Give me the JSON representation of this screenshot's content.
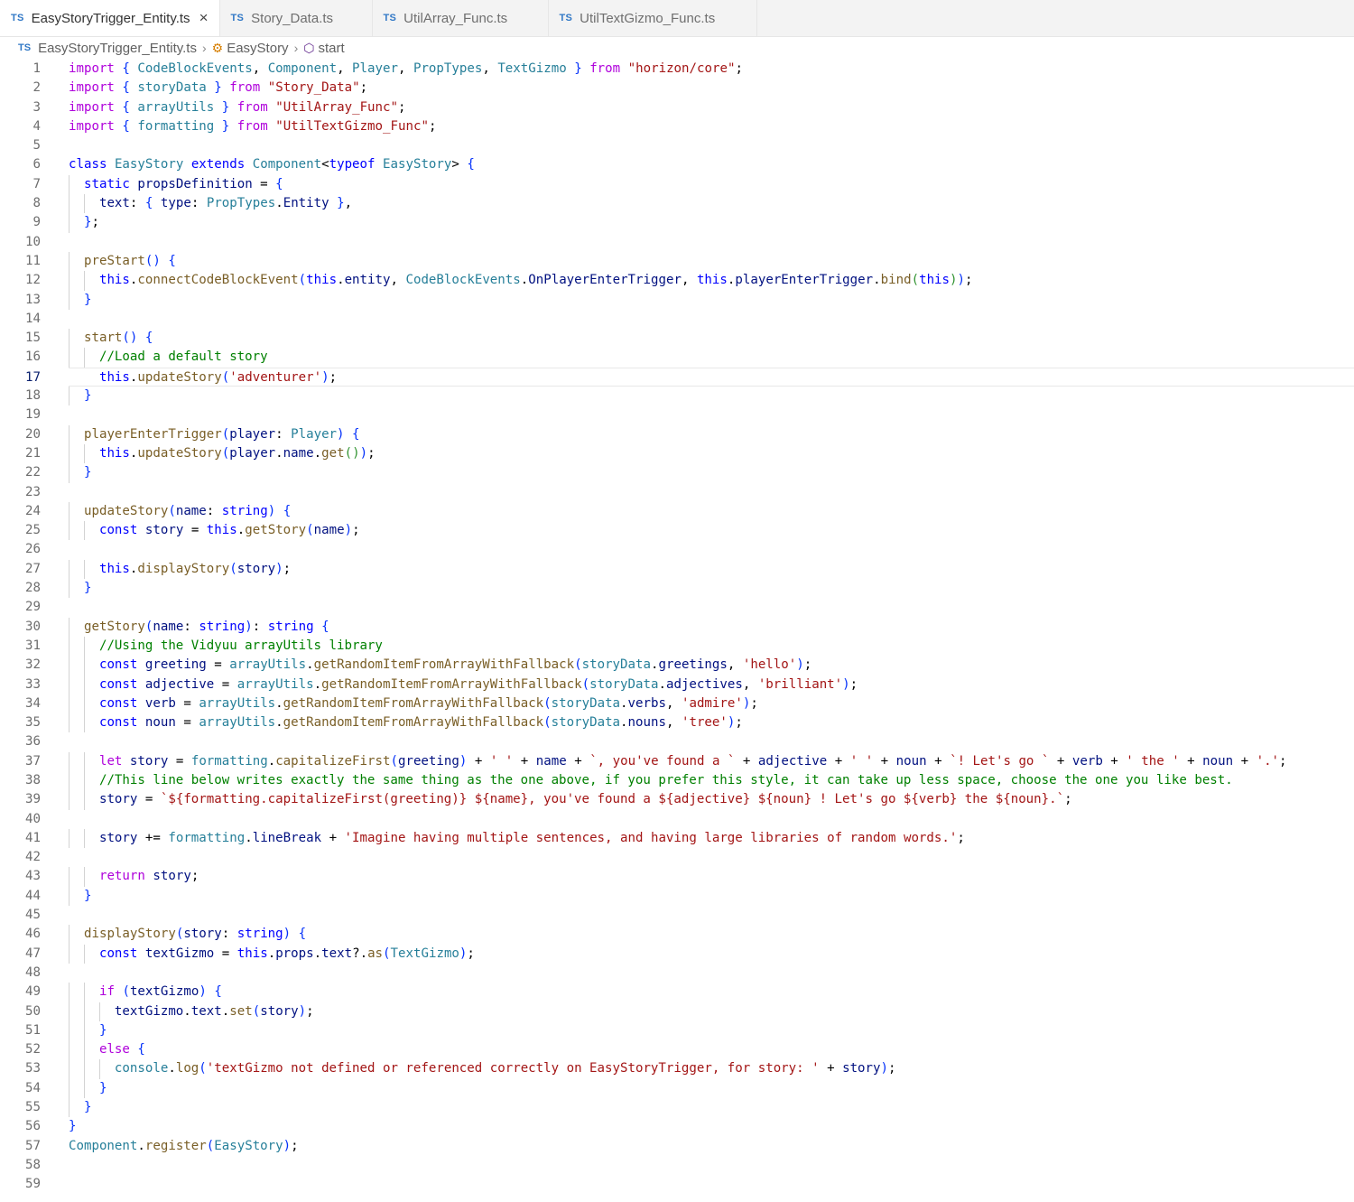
{
  "tabs": [
    {
      "badge": "TS",
      "label": "EasyStoryTrigger_Entity.ts",
      "active": true
    },
    {
      "badge": "TS",
      "label": "Story_Data.ts",
      "active": false
    },
    {
      "badge": "TS",
      "label": "UtilArray_Func.ts",
      "active": false
    },
    {
      "badge": "TS",
      "label": "UtilTextGizmo_Func.ts",
      "active": false
    }
  ],
  "tab_close_icon": "close-icon",
  "breadcrumb": {
    "badge": "TS",
    "file": "EasyStoryTrigger_Entity.ts",
    "class_name": "EasyStory",
    "method_name": "start"
  },
  "editor": {
    "current_line": 17,
    "line_numbers": [
      "1",
      "2",
      "3",
      "4",
      "5",
      "6",
      "7",
      "8",
      "9",
      "10",
      "11",
      "12",
      "13",
      "14",
      "15",
      "16",
      "17",
      "18",
      "19",
      "20",
      "21",
      "22",
      "23",
      "24",
      "25",
      "26",
      "27",
      "28",
      "29",
      "30",
      "31",
      "32",
      "33",
      "34",
      "35",
      "36",
      "37",
      "38",
      "39",
      "40",
      "41",
      "42",
      "43",
      "44",
      "45",
      "46",
      "47",
      "48",
      "49",
      "50",
      "51",
      "52",
      "53",
      "54",
      "55",
      "56",
      "57",
      "58",
      "59"
    ],
    "lines": [
      "import { CodeBlockEvents, Component, Player, PropTypes, TextGizmo } from \"horizon/core\";",
      "import { storyData } from \"Story_Data\";",
      "import { arrayUtils } from \"UtilArray_Func\";",
      "import { formatting } from \"UtilTextGizmo_Func\";",
      "",
      "class EasyStory extends Component<typeof EasyStory> {",
      "  static propsDefinition = {",
      "    text: { type: PropTypes.Entity },",
      "  };",
      "",
      "  preStart() {",
      "    this.connectCodeBlockEvent(this.entity, CodeBlockEvents.OnPlayerEnterTrigger, this.playerEnterTrigger.bind(this));",
      "  }",
      "",
      "  start() {",
      "    //Load a default story",
      "    this.updateStory('adventurer');",
      "  }",
      "",
      "  playerEnterTrigger(player: Player) {",
      "    this.updateStory(player.name.get());",
      "  }",
      "",
      "  updateStory(name: string) {",
      "    const story = this.getStory(name);",
      "",
      "    this.displayStory(story);",
      "  }",
      "",
      "  getStory(name: string): string {",
      "    //Using the Vidyuu arrayUtils library",
      "    const greeting = arrayUtils.getRandomItemFromArrayWithFallback(storyData.greetings, 'hello');",
      "    const adjective = arrayUtils.getRandomItemFromArrayWithFallback(storyData.adjectives, 'brilliant');",
      "    const verb = arrayUtils.getRandomItemFromArrayWithFallback(storyData.verbs, 'admire');",
      "    const noun = arrayUtils.getRandomItemFromArrayWithFallback(storyData.nouns, 'tree');",
      "",
      "    let story = formatting.capitalizeFirst(greeting) + ' ' + name + `, you've found a ` + adjective + ' ' + noun + `! Let's go ` + verb + ' the ' + noun + '.';",
      "    //This line below writes exactly the same thing as the one above, if you prefer this style, it can take up less space, choose the one you like best.",
      "    story = `${formatting.capitalizeFirst(greeting)} ${name}, you've found a ${adjective} ${noun} ! Let's go ${verb} the ${noun}.`;",
      "",
      "    story += formatting.lineBreak + 'Imagine having multiple sentences, and having large libraries of random words.';",
      "",
      "    return story;",
      "  }",
      "",
      "  displayStory(story: string) {",
      "    const textGizmo = this.props.text?.as(TextGizmo);",
      "",
      "    if (textGizmo) {",
      "      textGizmo.text.set(story);",
      "    }",
      "    else {",
      "      console.log('textGizmo not defined or referenced correctly on EasyStoryTrigger, for story: ' + story);",
      "    }",
      "  }",
      "}",
      "Component.register(EasyStory);",
      "",
      ""
    ]
  },
  "colors": {
    "keyword_control": "#af00db",
    "keyword_storage": "#0000ff",
    "string": "#a31515",
    "variable": "#001080",
    "function": "#795e26",
    "type": "#267f99",
    "comment": "#008000",
    "bracket_level_1": "#0431fa",
    "bracket_level_2": "#319331",
    "bracket_level_3": "#7b3814",
    "ts_badge": "#3178c6"
  }
}
